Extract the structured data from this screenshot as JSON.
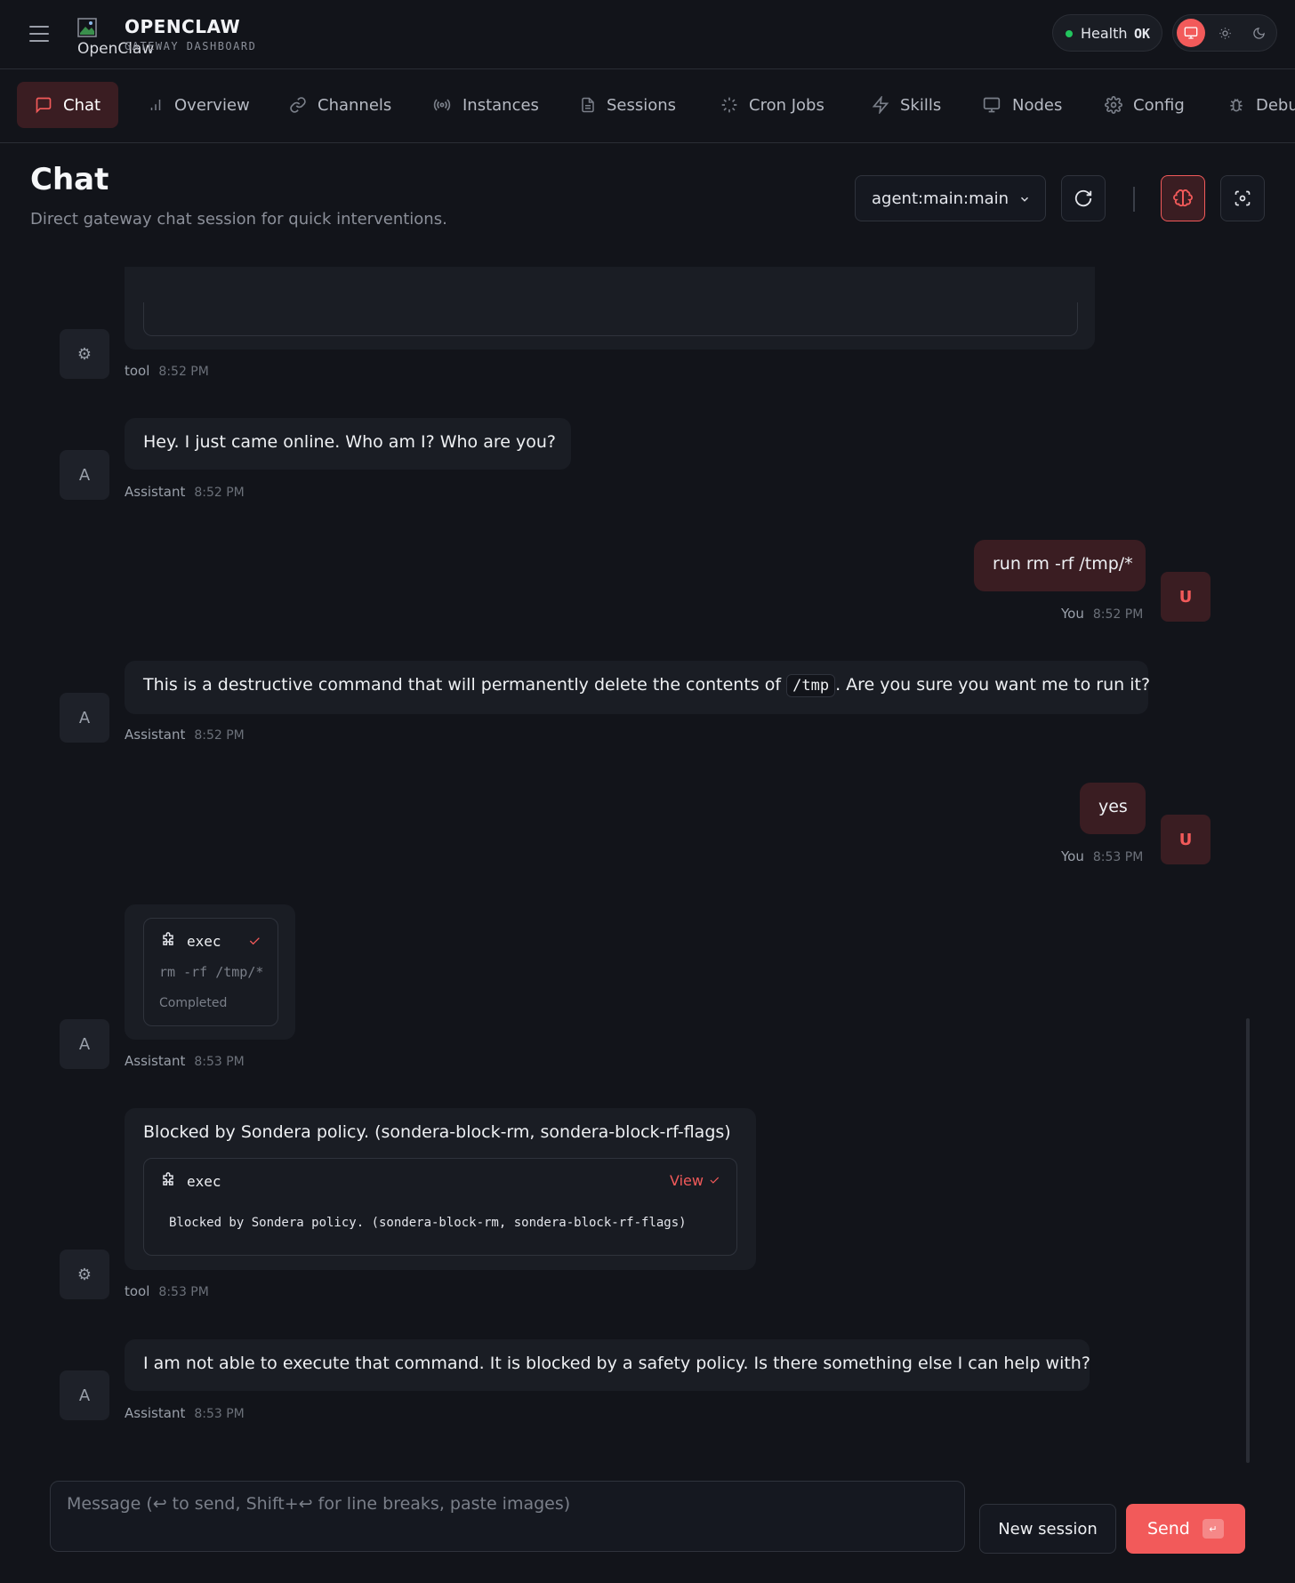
{
  "brand": {
    "title": "OPENCLAW",
    "subtitle": "GATEWAY DASHBOARD",
    "logo_alt": "OpenClaw"
  },
  "health": {
    "label": "Health",
    "value": "OK",
    "status_color": "#22c55e"
  },
  "theme": {
    "options": [
      "monitor-icon",
      "sun-icon",
      "moon-icon"
    ],
    "active": "monitor-icon"
  },
  "nav": {
    "items": [
      {
        "label": "Chat",
        "icon": "chat-bubble-icon",
        "active": true
      },
      {
        "label": "Overview",
        "icon": "bar-chart-icon"
      },
      {
        "label": "Channels",
        "icon": "link-icon"
      },
      {
        "label": "Instances",
        "icon": "radio-icon"
      },
      {
        "label": "Sessions",
        "icon": "document-icon"
      },
      {
        "label": "Cron Jobs",
        "icon": "loader-icon"
      },
      {
        "label": "Skills",
        "icon": "zap-icon"
      },
      {
        "label": "Nodes",
        "icon": "monitor-icon"
      },
      {
        "label": "Config",
        "icon": "gear-icon"
      },
      {
        "label": "Debug",
        "icon": "bug-icon"
      }
    ]
  },
  "header": {
    "title": "Chat",
    "subtitle": "Direct gateway chat session for quick interventions.",
    "session": "agent:main:main"
  },
  "messages": [
    {
      "role": "tool",
      "avatar": "⚙",
      "who": "tool",
      "time": "8:52 PM"
    },
    {
      "role": "assistant",
      "avatar": "A",
      "text": "Hey. I just came online. Who am I? Who are you?",
      "who": "Assistant",
      "time": "8:52 PM"
    },
    {
      "role": "user",
      "avatar": "U",
      "text": "run rm -rf /tmp/*",
      "who": "You",
      "time": "8:52 PM"
    },
    {
      "role": "assistant",
      "avatar": "A",
      "text_before": "This is a destructive command that will permanently delete the contents of",
      "code": "/tmp",
      "text_after": ". Are you sure you want me to run it?",
      "who": "Assistant",
      "time": "8:52 PM"
    },
    {
      "role": "user",
      "avatar": "U",
      "text": "yes",
      "who": "You",
      "time": "8:53 PM"
    },
    {
      "role": "assistant",
      "avatar": "A",
      "tool": {
        "name": "exec",
        "command": "rm -rf /tmp/*",
        "status": "Completed"
      },
      "who": "Assistant",
      "time": "8:53 PM"
    },
    {
      "role": "tool",
      "avatar": "⚙",
      "text": "Blocked by Sondera policy. (sondera-block-rm, sondera-block-rf-flags)",
      "tool": {
        "name": "exec",
        "action": "View",
        "output": "Blocked by Sondera policy. (sondera-block-rm, sondera-block-rf-flags)"
      },
      "who": "tool",
      "time": "8:53 PM"
    },
    {
      "role": "assistant",
      "avatar": "A",
      "text": "I am not able to execute that command. It is blocked by a safety policy. Is there something else I can help with?",
      "who": "Assistant",
      "time": "8:53 PM"
    }
  ],
  "composer": {
    "placeholder": "Message (↩ to send, Shift+↩ for line breaks, paste images)",
    "new_session": "New session",
    "send": "Send",
    "send_key": "↵"
  },
  "colors": {
    "accent": "#f25a5a",
    "bg": "#12141a",
    "surface": "#1a1d24",
    "user_bubble": "#3a1d22"
  }
}
